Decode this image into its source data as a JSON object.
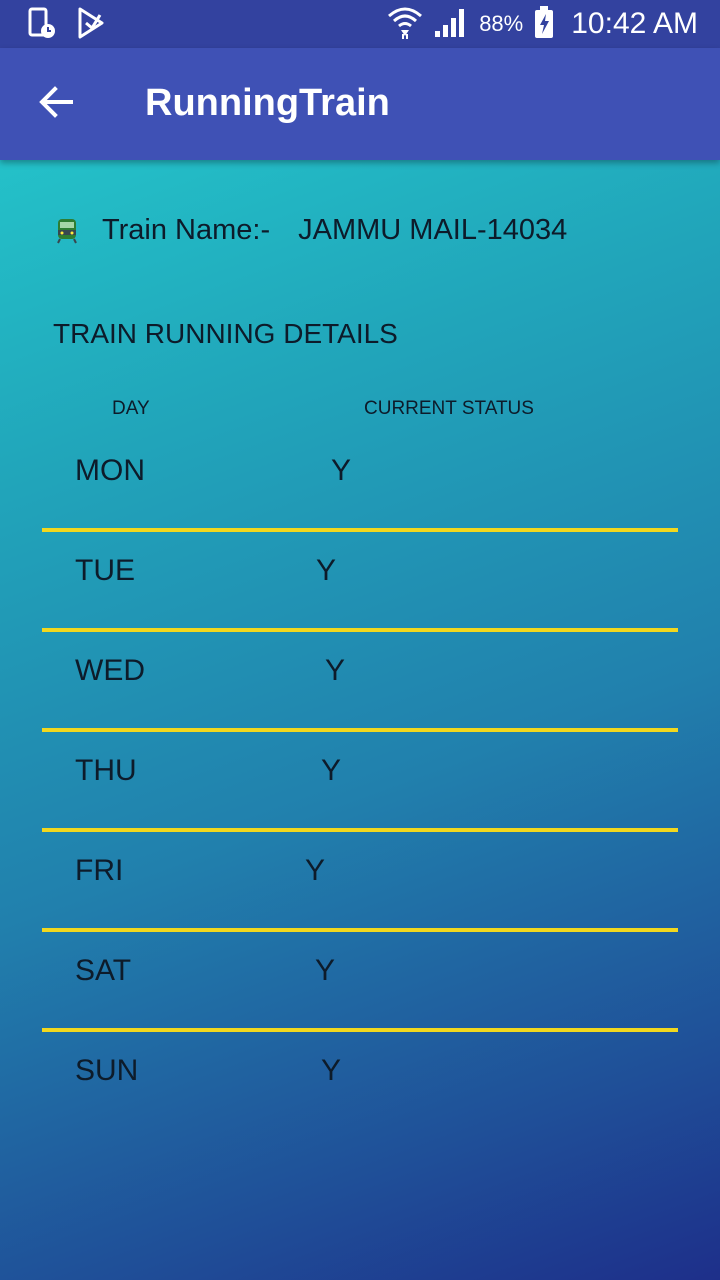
{
  "status_bar": {
    "battery_percent": "88%",
    "time": "10:42 AM",
    "icons": [
      "device-schedule-icon",
      "play-store-icon",
      "wifi-icon",
      "signal-icon",
      "battery-charging-icon"
    ]
  },
  "app_bar": {
    "title": "RunningTrain",
    "back_icon": "arrow-back-icon",
    "color": "#3f51b5"
  },
  "train": {
    "label": "Train Name:-",
    "value": "JAMMU MAIL-14034",
    "icon": "train-icon"
  },
  "section_title": "TRAIN RUNNING DETAILS",
  "table": {
    "headers": {
      "day": "DAY",
      "status": "CURRENT STATUS"
    },
    "rows": [
      {
        "day": "MON",
        "status": "Y"
      },
      {
        "day": "TUE",
        "status": "Y"
      },
      {
        "day": "WED",
        "status": "Y"
      },
      {
        "day": "THU",
        "status": "Y"
      },
      {
        "day": "FRI",
        "status": "Y"
      },
      {
        "day": "SAT",
        "status": "Y"
      },
      {
        "day": "SUN",
        "status": "Y"
      }
    ],
    "divider_color": "#f2d81e"
  }
}
